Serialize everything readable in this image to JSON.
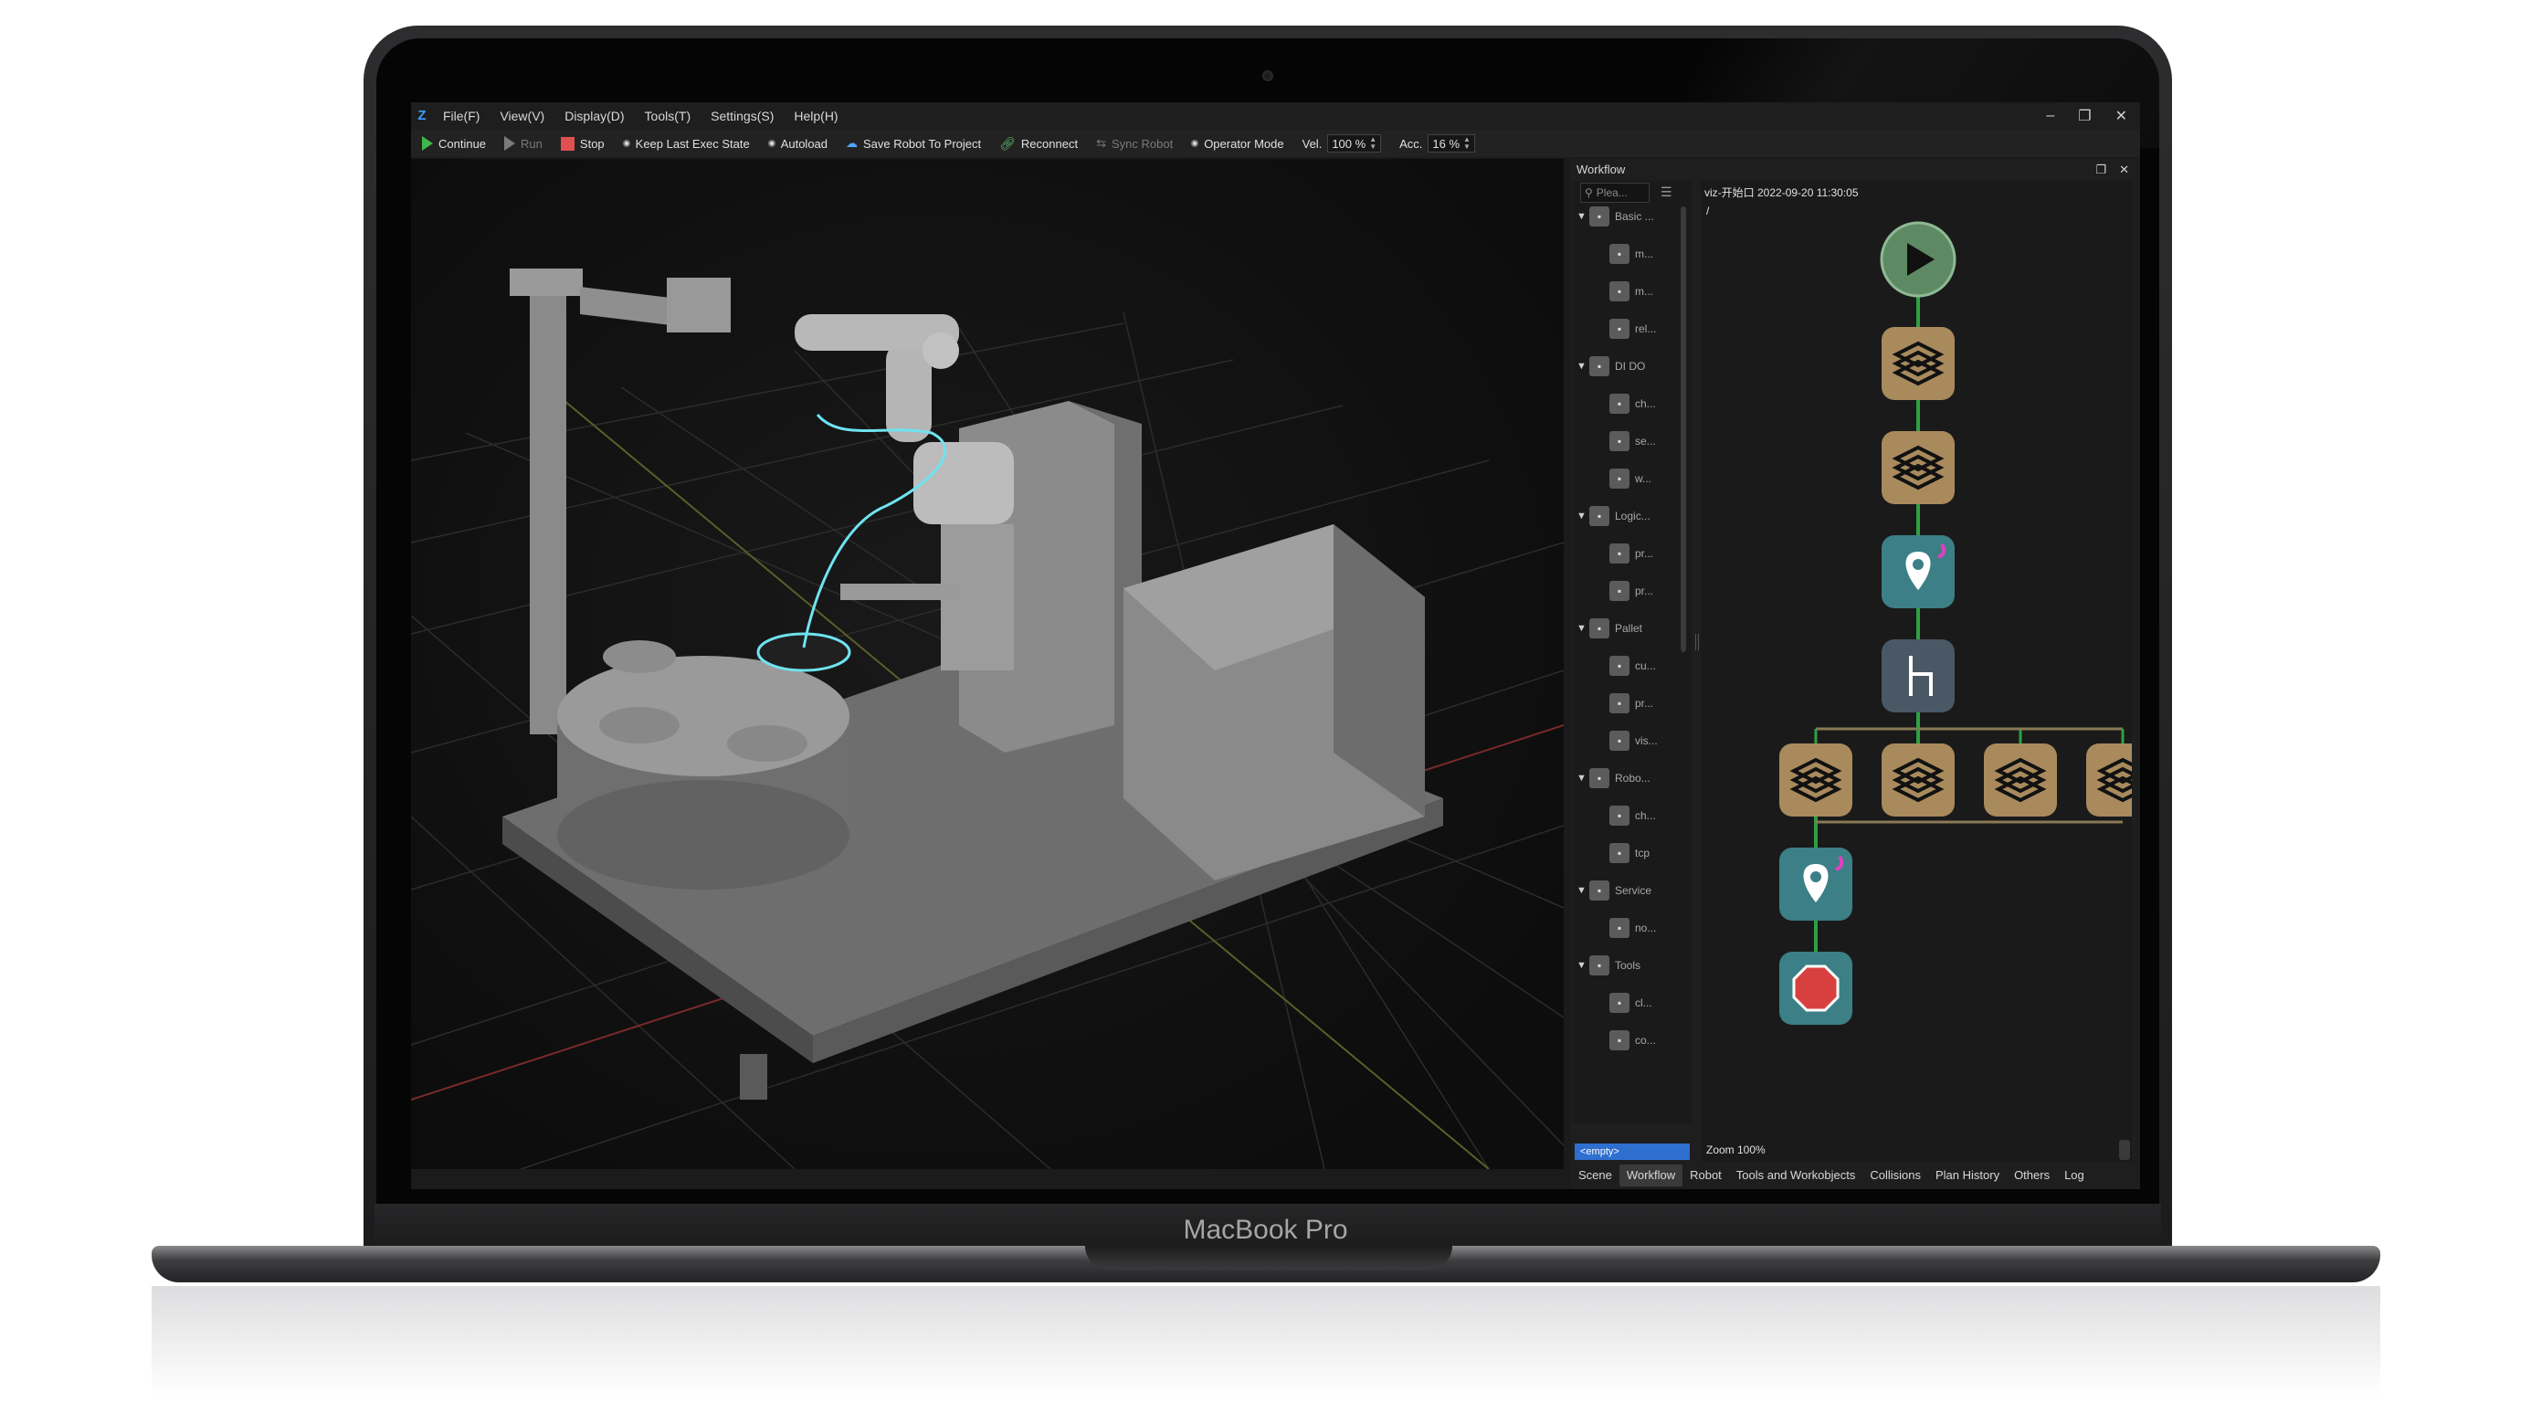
{
  "device": {
    "brand_label": "MacBook Pro"
  },
  "menubar": {
    "app_logo": "Z",
    "items": [
      "File(F)",
      "View(V)",
      "Display(D)",
      "Tools(T)",
      "Settings(S)",
      "Help(H)"
    ],
    "window_controls": {
      "minimize": "–",
      "restore": "❐",
      "close": "✕"
    }
  },
  "toolbar": {
    "continue_label": "Continue",
    "run_label": "Run",
    "stop_label": "Stop",
    "keep_last_exec_state_label": "Keep Last Exec State",
    "autoload_label": "Autoload",
    "save_robot_label": "Save Robot To Project",
    "reconnect_label": "Reconnect",
    "sync_robot_label": "Sync Robot",
    "operator_mode_label": "Operator Mode",
    "vel_label": "Vel.",
    "vel_value": "100 %",
    "acc_label": "Acc.",
    "acc_value": "16 %"
  },
  "workflow_panel": {
    "title": "Workflow",
    "search_placeholder": "Plea...",
    "project_title": "viz-开始口 2022-09-20 11:30:05",
    "path": "/",
    "zoom": "Zoom 100%",
    "empty_item": "<empty>",
    "tree": [
      {
        "label": "Basic ...",
        "group": true
      },
      {
        "label": "m...",
        "group": false
      },
      {
        "label": "m...",
        "group": false
      },
      {
        "label": "rel...",
        "group": false
      },
      {
        "label": "DI DO",
        "group": true
      },
      {
        "label": "ch...",
        "group": false
      },
      {
        "label": "se...",
        "group": false
      },
      {
        "label": "w...",
        "group": false
      },
      {
        "label": "Logic...",
        "group": true
      },
      {
        "label": "pr...",
        "group": false
      },
      {
        "label": "pr...",
        "group": false
      },
      {
        "label": "Pallet",
        "group": true
      },
      {
        "label": "cu...",
        "group": false
      },
      {
        "label": "pr...",
        "group": false
      },
      {
        "label": "vis...",
        "group": false
      },
      {
        "label": "Robo...",
        "group": true
      },
      {
        "label": "ch...",
        "group": false
      },
      {
        "label": "tcp",
        "group": false
      },
      {
        "label": "Service",
        "group": true
      },
      {
        "label": "no...",
        "group": false
      },
      {
        "label": "Tools",
        "group": true
      },
      {
        "label": "cl...",
        "group": false
      },
      {
        "label": "co...",
        "group": false
      }
    ],
    "tabs": [
      "Scene",
      "Workflow",
      "Robot",
      "Tools and Workobjects",
      "Collisions",
      "Plan History",
      "Others",
      "Log"
    ],
    "active_tab": "Workflow",
    "nodes": [
      {
        "kind": "start",
        "icon": "play-icon"
      },
      {
        "kind": "step",
        "icon": "layers-icon"
      },
      {
        "kind": "step",
        "icon": "layers-icon"
      },
      {
        "kind": "move",
        "icon": "location-pin-icon"
      },
      {
        "kind": "branch",
        "icon": "branch-icon"
      },
      {
        "kind": "step",
        "icon": "layers-icon"
      },
      {
        "kind": "step",
        "icon": "layers-icon"
      },
      {
        "kind": "step",
        "icon": "layers-icon"
      },
      {
        "kind": "step",
        "icon": "layers-icon"
      },
      {
        "kind": "move",
        "icon": "location-pin-icon"
      },
      {
        "kind": "stop",
        "icon": "stop-octagon-icon"
      }
    ]
  },
  "colors": {
    "accent_blue": "#2f6fd0",
    "node_start": "#5d8a63",
    "node_step": "#a88a5c",
    "node_move": "#3c7f86",
    "node_branch": "#4a5866",
    "node_stop": "#d84040",
    "connector_green": "#2ea043",
    "trajectory_cyan": "#6fe3f0",
    "grid_red": "#8a2b2b",
    "grid_yellow": "#6b6b2a"
  }
}
